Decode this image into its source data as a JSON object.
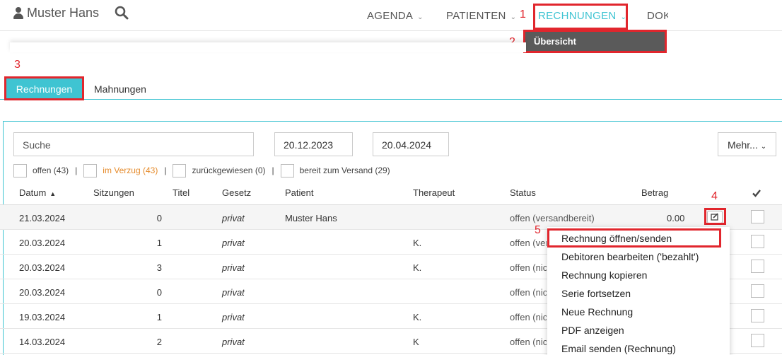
{
  "header": {
    "user_name": "Muster Hans",
    "nav": {
      "agenda": "AGENDA",
      "patienten": "PATIENTEN",
      "rechnungen": "RECHNUNGEN",
      "dok": "DOK"
    },
    "chevron": "⌄",
    "dropdown_item": "Übersicht"
  },
  "annotations": [
    "1",
    "2",
    "3",
    "4",
    "5"
  ],
  "tabs": {
    "rechnungen": "Rechnungen",
    "mahnungen": "Mahnungen"
  },
  "toolbar": {
    "search_placeholder": "Suche",
    "date_from": "20.12.2023",
    "date_to": "20.04.2024",
    "mehr_label": "Mehr..."
  },
  "filters": {
    "offen": "offen (43)",
    "im_verzug": "im Verzug (43)",
    "zurueckgewiesen": "zurückgewiesen (0)",
    "bereit": "bereit zum Versand (29)",
    "separator": "|"
  },
  "columns": {
    "datum": "Datum",
    "sitzungen": "Sitzungen",
    "titel": "Titel",
    "gesetz": "Gesetz",
    "patient": "Patient",
    "therapeut": "Therapeut",
    "status": "Status",
    "betrag": "Betrag"
  },
  "rows": [
    {
      "datum": "21.03.2024",
      "sitzungen": "0",
      "gesetz": "privat",
      "patient": "Muster Hans",
      "therapeut": "",
      "status": "offen (versandbereit)",
      "betrag": "0.00"
    },
    {
      "datum": "20.03.2024",
      "sitzungen": "1",
      "gesetz": "privat",
      "patient": "",
      "therapeut": "K.",
      "status": "offen (versandbereit)",
      "betrag": ""
    },
    {
      "datum": "20.03.2024",
      "sitzungen": "3",
      "gesetz": "privat",
      "patient": "",
      "therapeut": "K.",
      "status": "offen (nicht versandbereit)",
      "betrag": ""
    },
    {
      "datum": "20.03.2024",
      "sitzungen": "0",
      "gesetz": "privat",
      "patient": "",
      "therapeut": "",
      "status": "offen (nicht versandbereit)",
      "betrag": ""
    },
    {
      "datum": "19.03.2024",
      "sitzungen": "1",
      "gesetz": "privat",
      "patient": "",
      "therapeut": "K.",
      "status": "offen (nicht versandbereit)",
      "betrag": ""
    },
    {
      "datum": "14.03.2024",
      "sitzungen": "2",
      "gesetz": "privat",
      "patient": "",
      "therapeut": "K",
      "status": "offen (nicht versandbereit)",
      "betrag": ""
    }
  ],
  "context_menu": [
    "Rechnung öffnen/senden",
    "Debitoren bearbeiten ('bezahlt')",
    "Rechnung kopieren",
    "Serie fortsetzen",
    "Neue Rechnung",
    "PDF anzeigen",
    "Email senden (Rechnung)"
  ],
  "icons": {
    "user": "user-icon",
    "search": "search-icon",
    "edit": "edit-icon",
    "check": "check-icon",
    "sort": "sort-asc-icon"
  },
  "colors": {
    "accent": "#3fc4d2",
    "annotation": "#e1262d",
    "overdue": "#e58a2a",
    "dropdown_bg": "#5a5a5a"
  }
}
